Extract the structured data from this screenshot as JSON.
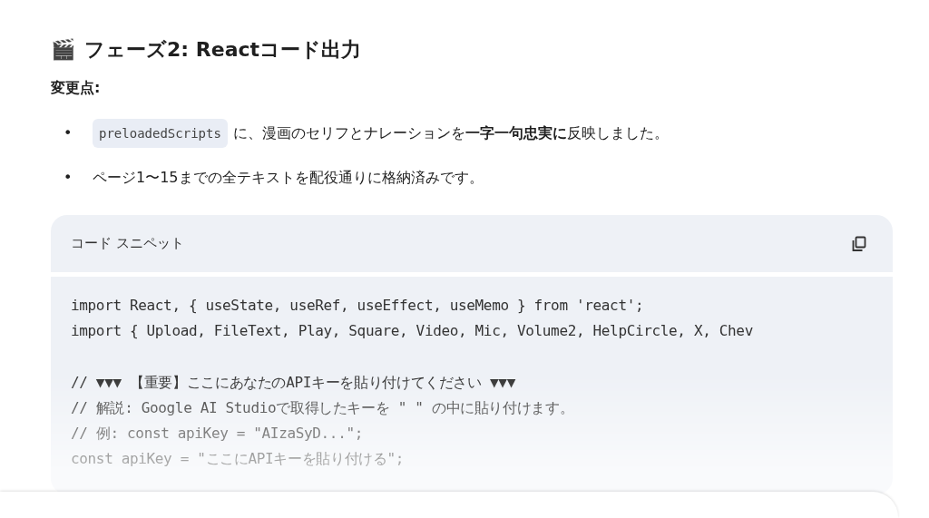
{
  "heading": {
    "emoji": "🎬",
    "title": "フェーズ2: Reactコード出力"
  },
  "subheading": "変更点:",
  "bullets": [
    {
      "marker": "•",
      "code": "preloadedScripts",
      "text": "に、漫画のセリフとナレーションを**一字一句忠実に**反映しました。"
    },
    {
      "marker": "•",
      "text": "ページ1〜15までの全テキストを配役通りに格納済みです。"
    }
  ],
  "code_block": {
    "title": "コード スニペット",
    "lines": [
      {
        "kind": "code",
        "text": "import React, { useState, useRef, useEffect, useMemo } from 'react';"
      },
      {
        "kind": "code",
        "text": "import { Upload, FileText, Play, Square, Video, Mic, Volume2, HelpCircle, X, Chev"
      },
      {
        "kind": "blank"
      },
      {
        "kind": "code",
        "text": "// ▼▼▼ 【重要】ここにあなたのAPIキーを貼り付けてください ▼▼▼"
      },
      {
        "kind": "code",
        "text": "// 解説: Google AI Studioで取得したキーを \" \" の中に貼り付けます。"
      },
      {
        "kind": "code",
        "text": "// 例: const apiKey = \"AIzaSyD...\";"
      },
      {
        "kind": "code",
        "text": "const apiKey = \"ここにAPIキーを貼り付ける\";"
      }
    ]
  }
}
